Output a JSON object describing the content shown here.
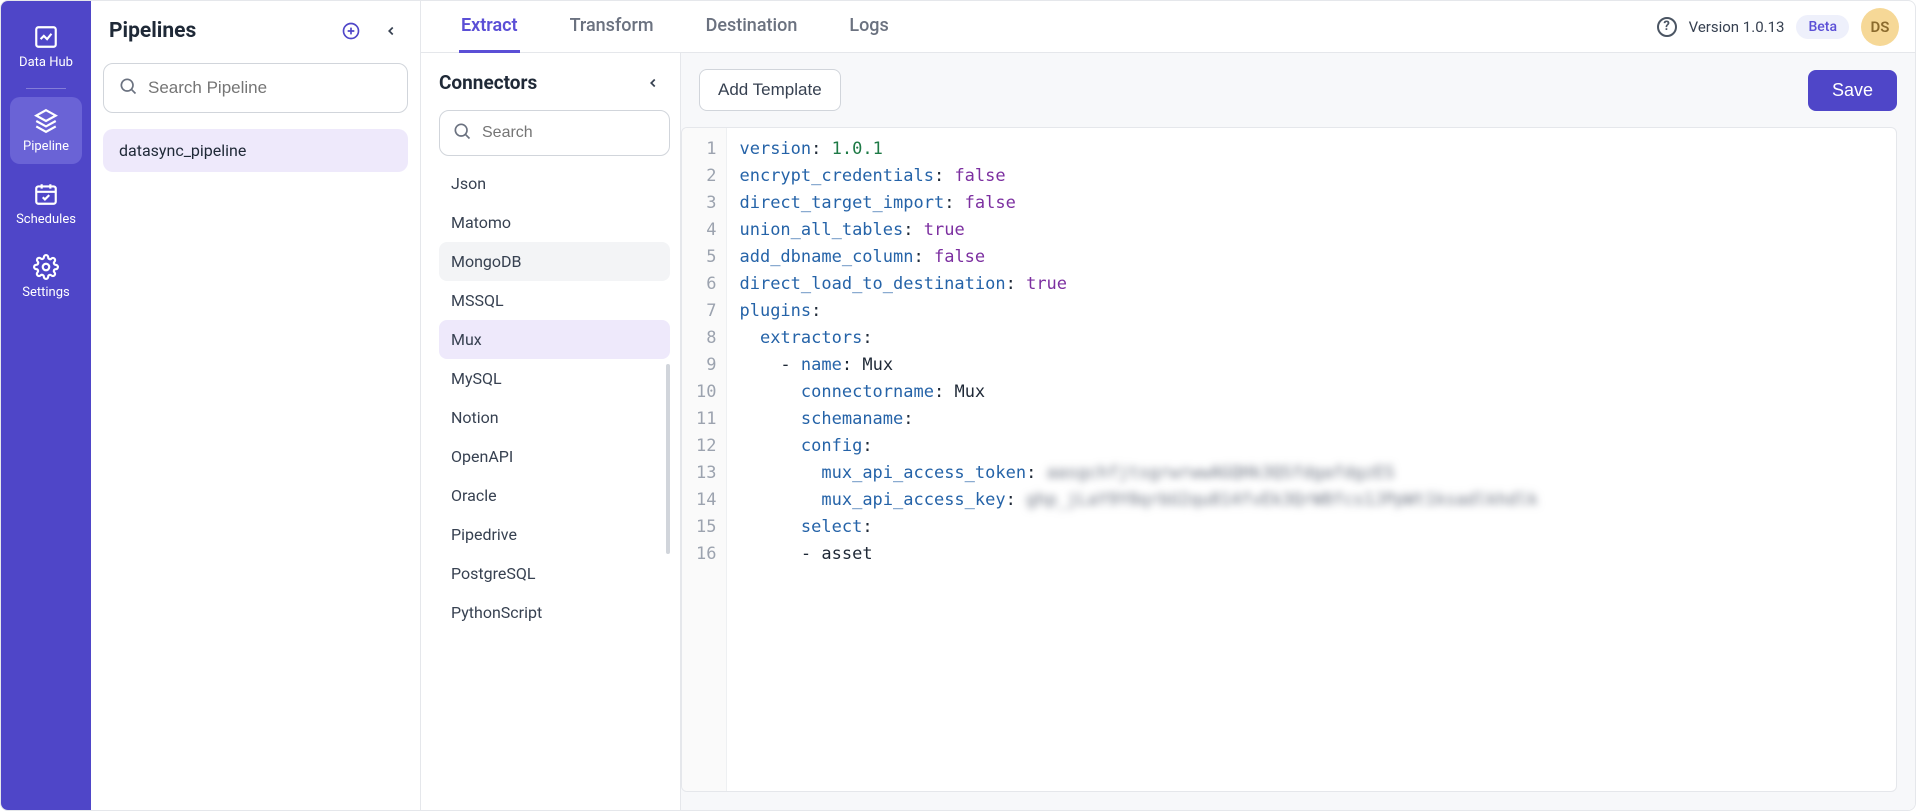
{
  "nav": {
    "items": [
      {
        "label": "Data Hub"
      },
      {
        "label": "Pipeline"
      },
      {
        "label": "Schedules"
      },
      {
        "label": "Settings"
      }
    ]
  },
  "pipelines": {
    "title": "Pipelines",
    "search_placeholder": "Search Pipeline",
    "items": [
      {
        "name": "datasync_pipeline"
      }
    ]
  },
  "tabs": [
    {
      "label": "Extract"
    },
    {
      "label": "Transform"
    },
    {
      "label": "Destination"
    },
    {
      "label": "Logs"
    }
  ],
  "topbar": {
    "version": "Version 1.0.13",
    "beta": "Beta",
    "avatar": "DS"
  },
  "connectors": {
    "title": "Connectors",
    "search_placeholder": "Search",
    "items": [
      "Json",
      "Matomo",
      "MongoDB",
      "MSSQL",
      "Mux",
      "MySQL",
      "Notion",
      "OpenAPI",
      "Oracle",
      "Pipedrive",
      "PostgreSQL",
      "PythonScript"
    ],
    "selected_index": 4,
    "hover_index": 2
  },
  "editor": {
    "add_template": "Add Template",
    "save": "Save",
    "lines": [
      [
        {
          "t": "key",
          "v": "version"
        },
        {
          "t": "p",
          "v": ": "
        },
        {
          "t": "num",
          "v": "1.0.1"
        }
      ],
      [
        {
          "t": "key",
          "v": "encrypt_credentials"
        },
        {
          "t": "p",
          "v": ": "
        },
        {
          "t": "bool",
          "v": "false"
        }
      ],
      [
        {
          "t": "key",
          "v": "direct_target_import"
        },
        {
          "t": "p",
          "v": ": "
        },
        {
          "t": "bool",
          "v": "false"
        }
      ],
      [
        {
          "t": "key",
          "v": "union_all_tables"
        },
        {
          "t": "p",
          "v": ": "
        },
        {
          "t": "bool",
          "v": "true"
        }
      ],
      [
        {
          "t": "key",
          "v": "add_dbname_column"
        },
        {
          "t": "p",
          "v": ": "
        },
        {
          "t": "bool",
          "v": "false"
        }
      ],
      [
        {
          "t": "key",
          "v": "direct_load_to_destination"
        },
        {
          "t": "p",
          "v": ": "
        },
        {
          "t": "bool",
          "v": "true"
        }
      ],
      [
        {
          "t": "key",
          "v": "plugins"
        },
        {
          "t": "p",
          "v": ":"
        }
      ],
      [
        {
          "t": "p",
          "v": "  "
        },
        {
          "t": "key",
          "v": "extractors"
        },
        {
          "t": "p",
          "v": ":"
        }
      ],
      [
        {
          "t": "p",
          "v": "    - "
        },
        {
          "t": "key",
          "v": "name"
        },
        {
          "t": "p",
          "v": ": "
        },
        {
          "t": "str",
          "v": "Mux"
        }
      ],
      [
        {
          "t": "p",
          "v": "      "
        },
        {
          "t": "key",
          "v": "connectorname"
        },
        {
          "t": "p",
          "v": ": "
        },
        {
          "t": "str",
          "v": "Mux"
        }
      ],
      [
        {
          "t": "p",
          "v": "      "
        },
        {
          "t": "key",
          "v": "schemaname"
        },
        {
          "t": "p",
          "v": ":"
        }
      ],
      [
        {
          "t": "p",
          "v": "      "
        },
        {
          "t": "key",
          "v": "config"
        },
        {
          "t": "p",
          "v": ":"
        }
      ],
      [
        {
          "t": "p",
          "v": "        "
        },
        {
          "t": "key",
          "v": "mux_api_access_token"
        },
        {
          "t": "p",
          "v": ": "
        },
        {
          "t": "blur",
          "v": "aasgchfjtsgrwrwwAGQHk3QSfdgafdgzES"
        }
      ],
      [
        {
          "t": "p",
          "v": "        "
        },
        {
          "t": "key",
          "v": "mux_api_access_key"
        },
        {
          "t": "p",
          "v": ": "
        },
        {
          "t": "blur",
          "v": "ghp_jLaY9Y0qrbU2qu814fvEk3QrW8fcs1JPpWt1ksadlkhdlk"
        }
      ],
      [
        {
          "t": "p",
          "v": "      "
        },
        {
          "t": "key",
          "v": "select"
        },
        {
          "t": "p",
          "v": ":"
        }
      ],
      [
        {
          "t": "p",
          "v": "      - "
        },
        {
          "t": "str",
          "v": "asset"
        }
      ]
    ]
  }
}
